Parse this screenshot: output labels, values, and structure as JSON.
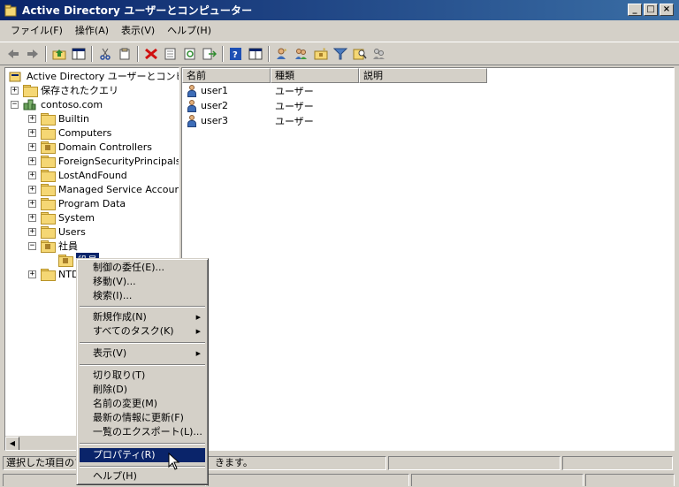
{
  "window": {
    "title": "Active Directory ユーザーとコンピューター",
    "controls": {
      "minimize": "_",
      "maximize": "□",
      "close": "×"
    }
  },
  "menubar": {
    "items": [
      "ファイル(F)",
      "操作(A)",
      "表示(V)",
      "ヘルプ(H)"
    ]
  },
  "toolbar": {
    "icons": [
      "back-icon",
      "forward-icon",
      "up-icon",
      "show-hide-tree-icon",
      "cut-icon",
      "copy-icon",
      "delete-icon",
      "properties-icon",
      "refresh-icon",
      "export-icon",
      "help-icon",
      "console-icon",
      "new-user-icon",
      "new-group-icon",
      "new-ou-icon",
      "filter-icon",
      "find-icon",
      "add-to-group-icon"
    ]
  },
  "tree": {
    "root": "Active Directory ユーザーとコンピュ",
    "saved_queries": "保存されたクエリ",
    "domain": "contoso.com",
    "children": [
      "Builtin",
      "Computers",
      "Domain Controllers",
      "ForeignSecurityPrincipals",
      "LostAndFound",
      "Managed Service Accoun",
      "Program Data",
      "System",
      "Users",
      "社員"
    ],
    "sub_ou": "役員",
    "last_item": "NTD"
  },
  "list": {
    "columns": [
      "名前",
      "種類",
      "説明"
    ],
    "rows": [
      {
        "name": "user1",
        "type": "ユーザー",
        "desc": ""
      },
      {
        "name": "user2",
        "type": "ユーザー",
        "desc": ""
      },
      {
        "name": "user3",
        "type": "ユーザー",
        "desc": ""
      }
    ]
  },
  "context_menu": {
    "items": {
      "delegate": "制御の委任(E)...",
      "move": "移動(V)...",
      "find": "検索(I)...",
      "new": "新規作成(N)",
      "all_tasks": "すべてのタスク(K)",
      "view": "表示(V)",
      "cut": "切り取り(T)",
      "delete": "削除(D)",
      "rename": "名前の変更(M)",
      "refresh": "最新の情報に更新(F)",
      "export": "一覧のエクスポート(L)...",
      "properties": "プロパティ(R)",
      "help": "ヘルプ(H)"
    },
    "selected": "プロパティ(R)"
  },
  "status": {
    "left": "選択した項目のプ",
    "mid": "きます。"
  }
}
